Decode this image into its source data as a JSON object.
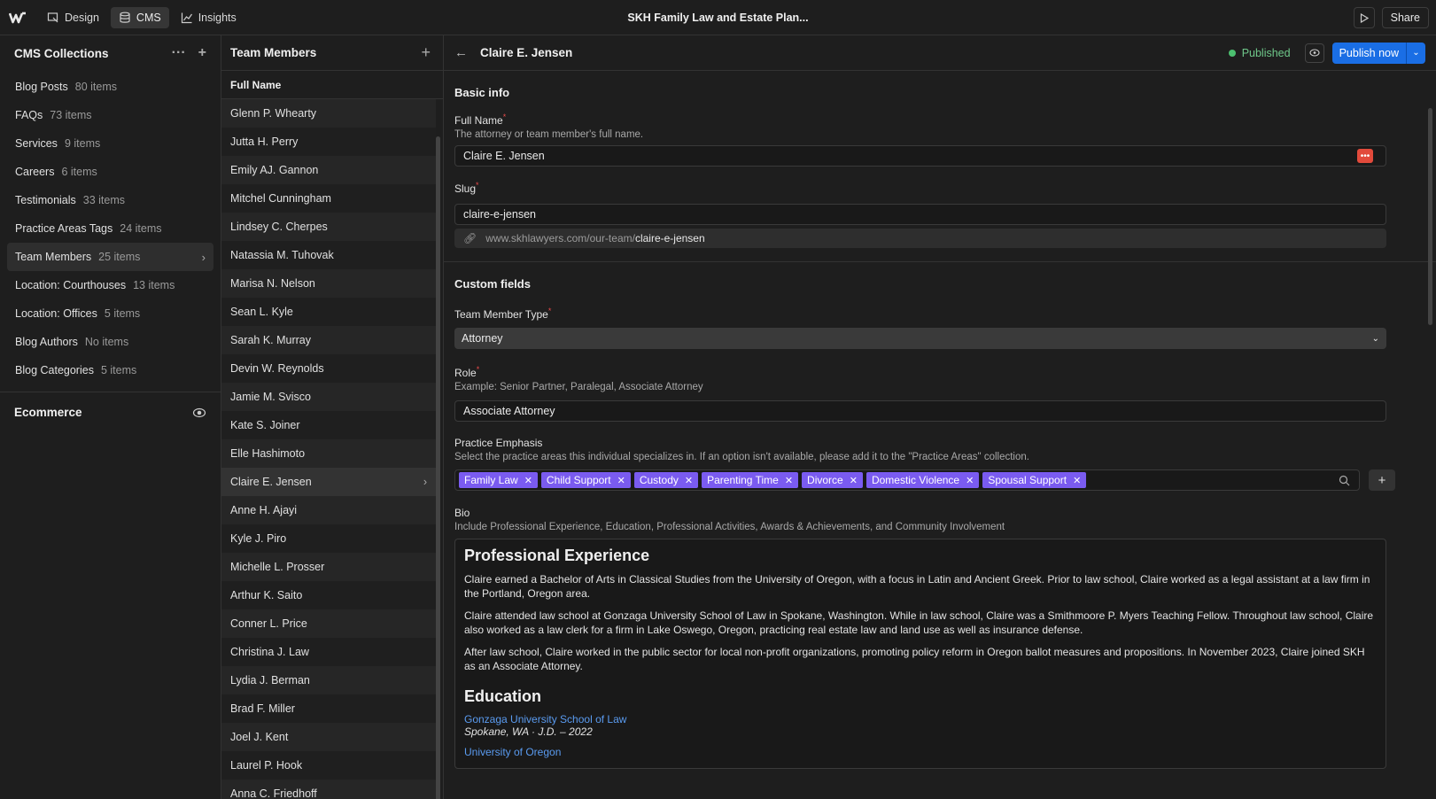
{
  "topbar": {
    "tabs": [
      {
        "label": "Design",
        "icon": "design-icon"
      },
      {
        "label": "CMS",
        "icon": "database-icon"
      },
      {
        "label": "Insights",
        "icon": "chart-icon"
      }
    ],
    "site_title": "SKH Family Law and Estate Plan...",
    "share_label": "Share"
  },
  "collections": {
    "title": "CMS Collections",
    "items": [
      {
        "label": "Blog Posts",
        "count": "80 items"
      },
      {
        "label": "FAQs",
        "count": "73 items"
      },
      {
        "label": "Services",
        "count": "9 items"
      },
      {
        "label": "Careers",
        "count": "6 items"
      },
      {
        "label": "Testimonials",
        "count": "33 items"
      },
      {
        "label": "Practice Areas Tags",
        "count": "24 items"
      },
      {
        "label": "Team Members",
        "count": "25 items"
      },
      {
        "label": "Location: Courthouses",
        "count": "13 items"
      },
      {
        "label": "Location: Offices",
        "count": "5 items"
      },
      {
        "label": "Blog Authors",
        "count": "No items"
      },
      {
        "label": "Blog Categories",
        "count": "5 items"
      }
    ],
    "active_index": 6,
    "ecommerce_label": "Ecommerce"
  },
  "items_list": {
    "title": "Team Members",
    "column_header": "Full Name",
    "rows": [
      "Glenn P. Whearty",
      "Jutta H. Perry",
      "Emily AJ. Gannon",
      "Mitchel Cunningham",
      "Lindsey C. Cherpes",
      "Natassia M. Tuhovak",
      "Marisa N. Nelson",
      "Sean L. Kyle",
      "Sarah K. Murray",
      "Devin W. Reynolds",
      "Jamie M. Svisco",
      "Kate S. Joiner",
      "Elle Hashimoto",
      "Claire E. Jensen",
      "Anne H. Ajayi",
      "Kyle J. Piro",
      "Michelle L. Prosser",
      "Arthur K. Saito",
      "Conner L. Price",
      "Christina J. Law",
      "Lydia J. Berman",
      "Brad F. Miller",
      "Joel J. Kent",
      "Laurel P. Hook",
      "Anna C. Friedhoff"
    ],
    "selected_index": 13
  },
  "editor": {
    "item_name": "Claire E. Jensen",
    "status": "Published",
    "publish_label": "Publish now",
    "basic_info": "Basic info",
    "full_name_label": "Full Name",
    "full_name_help": "The attorney or team member's full name.",
    "full_name_value": "Claire E. Jensen",
    "slug_label": "Slug",
    "slug_value": "claire-e-jensen",
    "url_prefix": "www.skhlawyers.com/our-team/",
    "url_slug": "claire-e-jensen",
    "custom_fields": "Custom fields",
    "type_label": "Team Member Type",
    "type_value": "Attorney",
    "role_label": "Role",
    "role_help": "Example: Senior Partner, Paralegal, Associate Attorney",
    "role_value": "Associate Attorney",
    "practice_label": "Practice Emphasis",
    "practice_help": "Select the practice areas this individual specializes in. If an option isn't available, please add it to the \"Practice Areas\" collection.",
    "practice_tags": [
      "Family Law",
      "Child Support",
      "Custody",
      "Parenting Time",
      "Divorce",
      "Domestic Violence",
      "Spousal Support"
    ],
    "bio_label": "Bio",
    "bio_help": "Include Professional Experience, Education, Professional Activities, Awards & Achievements, and Community Involvement",
    "bio": {
      "h_experience": "Professional Experience",
      "p1": "Claire earned a Bachelor of Arts in Classical Studies from the University of Oregon, with a focus in Latin and Ancient Greek. Prior to law school, Claire worked as a legal assistant at a law firm in the Portland, Oregon area.",
      "p2": "Claire attended law school at Gonzaga University School of Law in Spokane, Washington. While in law school, Claire was a Smithmoore P. Myers Teaching Fellow. Throughout law school, Claire also worked as a law clerk for a firm in Lake Oswego, Oregon, practicing real estate law and land use as well as insurance defense.",
      "p3": "After law school, Claire worked in the public sector for local non-profit organizations, promoting policy reform in Oregon ballot measures and propositions. In November 2023, Claire joined SKH as an Associate Attorney.",
      "h_education": "Education",
      "edu1_link": "Gonzaga University School of Law",
      "edu1_detail": "Spokane, WA · J.D. – 2022",
      "edu2_link": "University of Oregon"
    }
  },
  "colors": {
    "accent": "#1a6ee5",
    "tag": "#7a5bf0",
    "published": "#4cc070"
  }
}
